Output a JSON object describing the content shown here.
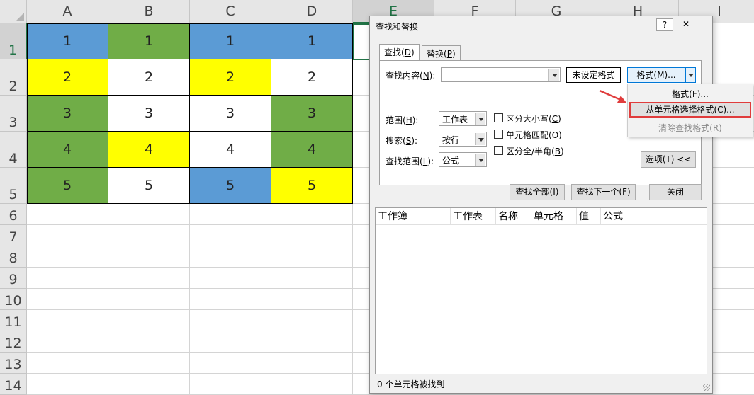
{
  "sheet": {
    "columns": [
      "A",
      "B",
      "C",
      "D",
      "E",
      "F",
      "G",
      "H",
      "I"
    ],
    "rows": [
      "1",
      "2",
      "3",
      "4",
      "5",
      "6",
      "7",
      "8",
      "9",
      "10",
      "11",
      "12",
      "13",
      "14"
    ],
    "cells": [
      [
        {
          "v": "1",
          "bg": "#5b9bd5"
        },
        {
          "v": "1",
          "bg": "#70ad47"
        },
        {
          "v": "1",
          "bg": "#5b9bd5"
        },
        {
          "v": "1",
          "bg": "#5b9bd5"
        }
      ],
      [
        {
          "v": "2",
          "bg": "#ffff00"
        },
        {
          "v": "2",
          "bg": "#ffffff"
        },
        {
          "v": "2",
          "bg": "#ffff00"
        },
        {
          "v": "2",
          "bg": "#ffffff"
        }
      ],
      [
        {
          "v": "3",
          "bg": "#70ad47"
        },
        {
          "v": "3",
          "bg": "#ffffff"
        },
        {
          "v": "3",
          "bg": "#ffffff"
        },
        {
          "v": "3",
          "bg": "#70ad47"
        }
      ],
      [
        {
          "v": "4",
          "bg": "#70ad47"
        },
        {
          "v": "4",
          "bg": "#ffff00"
        },
        {
          "v": "4",
          "bg": "#ffffff"
        },
        {
          "v": "4",
          "bg": "#70ad47"
        }
      ],
      [
        {
          "v": "5",
          "bg": "#70ad47"
        },
        {
          "v": "5",
          "bg": "#ffffff"
        },
        {
          "v": "5",
          "bg": "#5b9bd5"
        },
        {
          "v": "5",
          "bg": "#ffff00"
        }
      ]
    ],
    "selected_column": "E",
    "selected_row": "1"
  },
  "dialog": {
    "title": "查找和替换",
    "help_label": "?",
    "close_label": "✕",
    "tabs": [
      {
        "label": "查找(",
        "key": "D",
        "suffix": ")"
      },
      {
        "label": "替换(",
        "key": "P",
        "suffix": ")"
      }
    ],
    "find_what": {
      "label": "查找内容(",
      "key": "N",
      "suffix": "):",
      "value": ""
    },
    "format_preview": "未设定格式",
    "format_button": "格式(M)...",
    "scope": {
      "label": "范围(",
      "key": "H",
      "suffix": "):",
      "value": "工作表"
    },
    "search": {
      "label": "搜索(",
      "key": "S",
      "suffix": "):",
      "value": "按行"
    },
    "look_in": {
      "label": "查找范围(",
      "key": "L",
      "suffix": "):",
      "value": "公式"
    },
    "checkboxes": [
      {
        "label": "区分大小写(",
        "key": "C",
        "suffix": ")"
      },
      {
        "label": "单元格匹配(",
        "key": "O",
        "suffix": ")"
      },
      {
        "label": "区分全/半角(",
        "key": "B",
        "suffix": ")"
      }
    ],
    "options_button": "选项(T) <<",
    "find_all_button": "查找全部(I)",
    "find_next_button": "查找下一个(F)",
    "close_button": "关闭",
    "result_columns": [
      "工作簿",
      "工作表",
      "名称",
      "单元格",
      "值",
      "公式"
    ],
    "status": "0 个单元格被找到"
  },
  "format_menu": {
    "items": [
      {
        "label": "格式(F)...",
        "state": "normal"
      },
      {
        "label": "从单元格选择格式(C)...",
        "state": "highlighted"
      },
      {
        "label": "清除查找格式(R)",
        "state": "disabled"
      }
    ]
  },
  "colors": {
    "accent_green": "#217346",
    "annotation_red": "#e03c3c"
  }
}
